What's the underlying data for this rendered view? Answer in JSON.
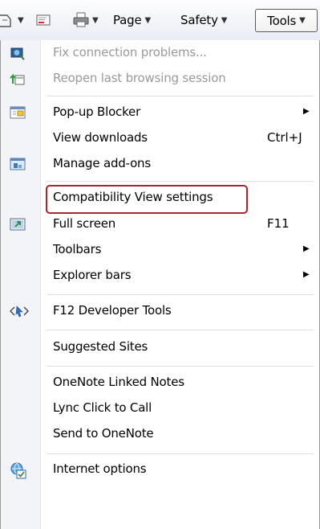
{
  "toolbar": {
    "page_label": "Page",
    "safety_label": "Safety",
    "tools_label": "Tools"
  },
  "menu": {
    "items": [
      {
        "label": "Fix connection problems...",
        "icon": "fix-connection-icon",
        "disabled": true
      },
      {
        "label": "Reopen last browsing session",
        "icon": "reopen-session-icon",
        "disabled": true
      },
      {
        "label": "Pop-up Blocker",
        "icon": "popup-blocker-icon",
        "submenu": true
      },
      {
        "label": "View downloads",
        "shortcut": "Ctrl+J"
      },
      {
        "label": "Manage add-ons",
        "icon": "addons-icon"
      },
      {
        "label": "Compatibility View settings",
        "highlighted": true
      },
      {
        "label": "Full screen",
        "icon": "fullscreen-icon",
        "shortcut": "F11"
      },
      {
        "label": "Toolbars",
        "submenu": true
      },
      {
        "label": "Explorer bars",
        "submenu": true
      },
      {
        "label": "F12 Developer Tools",
        "icon": "developer-tools-icon"
      },
      {
        "label": "Suggested Sites"
      },
      {
        "label": "OneNote Linked Notes"
      },
      {
        "label": "Lync Click to Call"
      },
      {
        "label": "Send to OneNote"
      },
      {
        "label": "Internet options",
        "icon": "internet-options-icon"
      }
    ]
  },
  "colors": {
    "highlight_border": "#a8242e",
    "disabled_text": "#9a9a9a",
    "gutter": "#f2f4f7"
  }
}
